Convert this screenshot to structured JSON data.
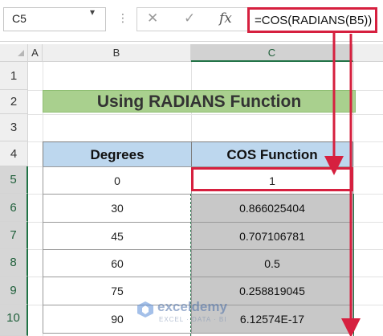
{
  "formula_bar": {
    "name_box": "C5",
    "formula": "=COS(RADIANS(B5))"
  },
  "columns": [
    "A",
    "B",
    "C"
  ],
  "rows": [
    "1",
    "2",
    "3",
    "4",
    "5",
    "6",
    "7",
    "8",
    "9",
    "10"
  ],
  "sheet": {
    "title": "Using RADIANS Function",
    "table": {
      "headers": [
        "Degrees",
        "COS Function"
      ],
      "rows": [
        {
          "degrees": "0",
          "cos": "1"
        },
        {
          "degrees": "30",
          "cos": "0.866025404"
        },
        {
          "degrees": "45",
          "cos": "0.707106781"
        },
        {
          "degrees": "60",
          "cos": "0.5"
        },
        {
          "degrees": "75",
          "cos": "0.258819045"
        },
        {
          "degrees": "90",
          "cos": "6.12574E-17"
        }
      ]
    }
  },
  "watermark": {
    "name": "exceldemy",
    "tagline": "EXCEL · DATA · BI"
  },
  "colors": {
    "annotation": "#d6203f",
    "title_fill": "#a9d08e",
    "header_fill": "#bdd7ee",
    "excel_green": "#217346"
  }
}
